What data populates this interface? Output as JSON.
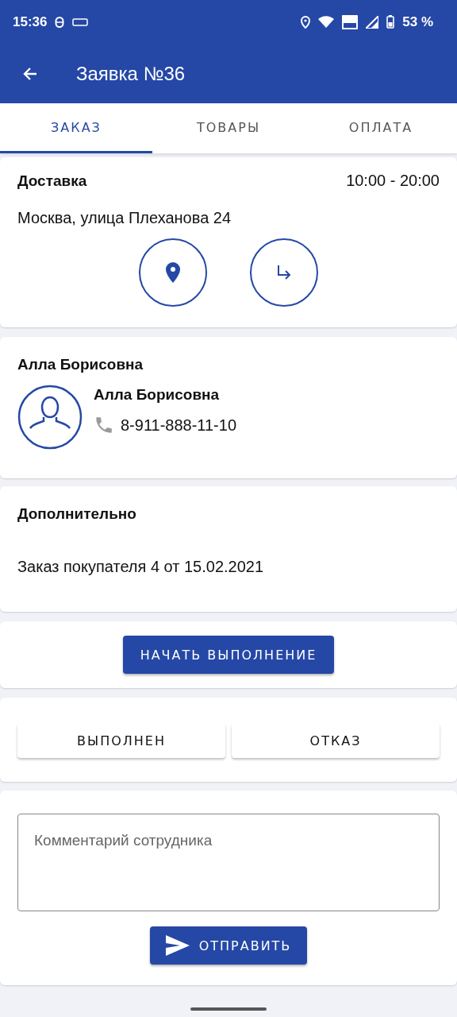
{
  "status_bar": {
    "time": "15:36",
    "battery": "53 %"
  },
  "app_bar": {
    "title": "Заявка №36"
  },
  "tabs": [
    {
      "label": "ЗАКАЗ",
      "selected": true
    },
    {
      "label": "ТОВАРЫ",
      "selected": false
    },
    {
      "label": "ОПЛАТА",
      "selected": false
    }
  ],
  "delivery": {
    "title": "Доставка",
    "time": "10:00 - 20:00",
    "address": "Москва, улица Плеханова 24"
  },
  "contact": {
    "title": "Алла Борисовна",
    "name": "Алла Борисовна",
    "phone": "8-911-888-11-10"
  },
  "extra": {
    "title": "Дополнительно",
    "text": "Заказ покупателя 4 от 15.02.2021"
  },
  "start_button": "НАЧАТЬ ВЫПОЛНЕНИЕ",
  "result_buttons": [
    "ВЫПОЛНЕН",
    "ОТКАЗ"
  ],
  "comment": {
    "placeholder": "Комментарий сотрудника"
  },
  "send_button": "ОТПРАВИТЬ"
}
